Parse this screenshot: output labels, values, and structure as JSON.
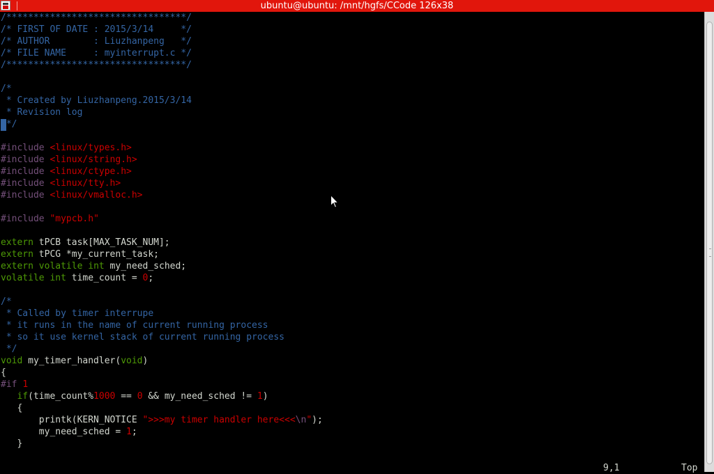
{
  "window": {
    "title": "ubuntu@ubuntu: /mnt/hgfs/CCode 126x38",
    "titlebar_color": "#e1160c"
  },
  "code_lines": [
    [
      {
        "t": "/*********************************/",
        "c": "comment"
      }
    ],
    [
      {
        "t": "/* FIRST OF DATE : 2015/3/14     */",
        "c": "comment"
      }
    ],
    [
      {
        "t": "/* AUTHOR        : Liuzhanpeng   */",
        "c": "comment"
      }
    ],
    [
      {
        "t": "/* FILE NAME     : myinterrupt.c */",
        "c": "comment"
      }
    ],
    [
      {
        "t": "/*********************************/",
        "c": "comment"
      }
    ],
    [],
    [
      {
        "t": "/*",
        "c": "comment"
      }
    ],
    [
      {
        "t": " * Created by Liuzhanpeng.2015/3/14",
        "c": "comment"
      }
    ],
    [
      {
        "t": " * Revision log",
        "c": "comment"
      }
    ],
    [
      {
        "t": " */",
        "c": "comment"
      }
    ],
    [],
    [
      {
        "t": "#include ",
        "c": "pre"
      },
      {
        "t": "<linux/types.h>",
        "c": "inc"
      }
    ],
    [
      {
        "t": "#include ",
        "c": "pre"
      },
      {
        "t": "<linux/string.h>",
        "c": "inc"
      }
    ],
    [
      {
        "t": "#include ",
        "c": "pre"
      },
      {
        "t": "<linux/ctype.h>",
        "c": "inc"
      }
    ],
    [
      {
        "t": "#include ",
        "c": "pre"
      },
      {
        "t": "<linux/tty.h>",
        "c": "inc"
      }
    ],
    [
      {
        "t": "#include ",
        "c": "pre"
      },
      {
        "t": "<linux/vmalloc.h>",
        "c": "inc"
      }
    ],
    [],
    [
      {
        "t": "#include ",
        "c": "pre"
      },
      {
        "t": "\"mypcb.h\"",
        "c": "str"
      }
    ],
    [],
    [
      {
        "t": "extern",
        "c": "type"
      },
      {
        "t": " tPCB task[MAX_TASK_NUM];",
        "c": "plain"
      }
    ],
    [
      {
        "t": "extern",
        "c": "type"
      },
      {
        "t": " tPCG *my_current_task;",
        "c": "plain"
      }
    ],
    [
      {
        "t": "extern",
        "c": "type"
      },
      {
        "t": " ",
        "c": "plain"
      },
      {
        "t": "volatile",
        "c": "type"
      },
      {
        "t": " ",
        "c": "plain"
      },
      {
        "t": "int",
        "c": "type"
      },
      {
        "t": " my_need_sched;",
        "c": "plain"
      }
    ],
    [
      {
        "t": "volatile",
        "c": "type"
      },
      {
        "t": " ",
        "c": "plain"
      },
      {
        "t": "int",
        "c": "type"
      },
      {
        "t": " time_count = ",
        "c": "plain"
      },
      {
        "t": "0",
        "c": "num"
      },
      {
        "t": ";",
        "c": "plain"
      }
    ],
    [],
    [
      {
        "t": "/*",
        "c": "comment"
      }
    ],
    [
      {
        "t": " * Called by timer interrupe",
        "c": "comment"
      }
    ],
    [
      {
        "t": " * it runs in the name of current running process",
        "c": "comment"
      }
    ],
    [
      {
        "t": " * so it use kernel stack of current running process",
        "c": "comment"
      }
    ],
    [
      {
        "t": " */",
        "c": "comment"
      }
    ],
    [
      {
        "t": "void",
        "c": "type"
      },
      {
        "t": " my_timer_handler(",
        "c": "plain"
      },
      {
        "t": "void",
        "c": "type"
      },
      {
        "t": ")",
        "c": "plain"
      }
    ],
    [
      {
        "t": "{",
        "c": "plain"
      }
    ],
    [
      {
        "t": "#if ",
        "c": "pre"
      },
      {
        "t": "1",
        "c": "num"
      }
    ],
    [
      {
        "t": "   ",
        "c": "plain"
      },
      {
        "t": "if",
        "c": "type"
      },
      {
        "t": "(time_count%",
        "c": "plain"
      },
      {
        "t": "1000",
        "c": "num"
      },
      {
        "t": " == ",
        "c": "plain"
      },
      {
        "t": "0",
        "c": "num"
      },
      {
        "t": " && my_need_sched != ",
        "c": "plain"
      },
      {
        "t": "1",
        "c": "num"
      },
      {
        "t": ")",
        "c": "plain"
      }
    ],
    [
      {
        "t": "   {",
        "c": "plain"
      }
    ],
    [
      {
        "t": "       printk(KERN_NOTICE ",
        "c": "plain"
      },
      {
        "t": "\">>>my timer handler here<<<",
        "c": "str"
      },
      {
        "t": "\\n",
        "c": "esc"
      },
      {
        "t": "\"",
        "c": "str"
      },
      {
        "t": ");",
        "c": "plain"
      }
    ],
    [
      {
        "t": "       my_need_sched = ",
        "c": "plain"
      },
      {
        "t": "1",
        "c": "num"
      },
      {
        "t": ";",
        "c": "plain"
      }
    ],
    [
      {
        "t": "   }",
        "c": "plain"
      }
    ]
  ],
  "status": {
    "ruler": "9,1",
    "scroll_position": "Top"
  },
  "colors": {
    "comment": "#3465a4",
    "preprocessor": "#75507b",
    "string": "#cc0000",
    "type": "#4e9a06",
    "text": "#d3d7cf",
    "background": "#000000"
  }
}
